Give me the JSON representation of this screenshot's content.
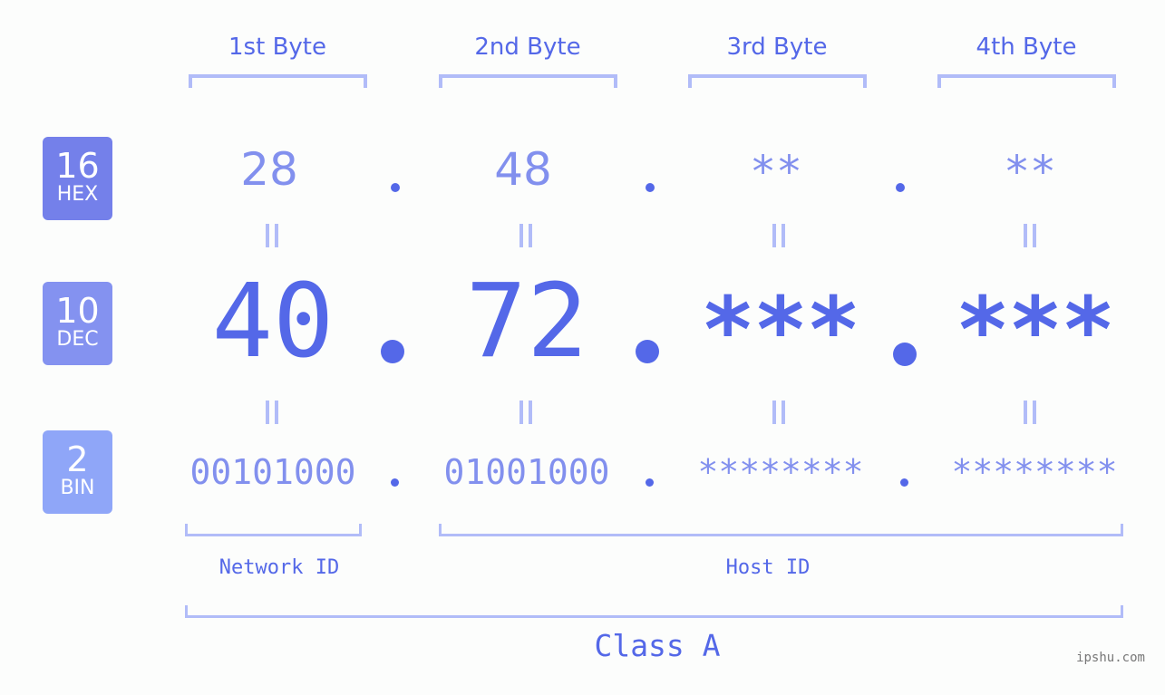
{
  "bytes": {
    "headers": [
      "1st Byte",
      "2nd Byte",
      "3rd Byte",
      "4th Byte"
    ]
  },
  "bases": {
    "hex": {
      "number": "16",
      "label": "HEX",
      "color": "#7480ea"
    },
    "dec": {
      "number": "10",
      "label": "DEC",
      "color": "#8492f0"
    },
    "bin": {
      "number": "2",
      "label": "BIN",
      "color": "#8fa6f8"
    }
  },
  "values": {
    "hex": [
      "28",
      "48",
      "**",
      "**"
    ],
    "dec": [
      "40",
      "72",
      "***",
      "***"
    ],
    "bin": [
      "00101000",
      "01001000",
      "********",
      "********"
    ]
  },
  "segments": {
    "network_id": "Network ID",
    "host_id": "Host ID"
  },
  "ip_class": "Class A",
  "watermark": "ipshu.com",
  "colors": {
    "accent": "#5468e8",
    "light_value": "#8290ee",
    "bracket": "#b1bcf8"
  }
}
